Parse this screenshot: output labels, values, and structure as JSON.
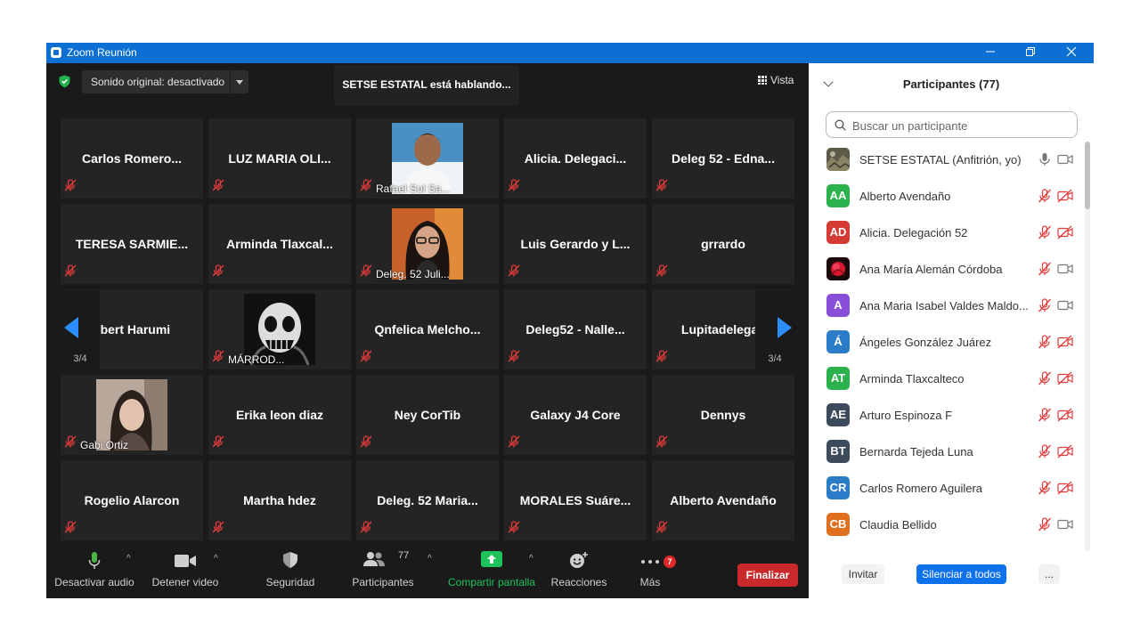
{
  "window": {
    "title": "Zoom Reunión"
  },
  "meeting": {
    "audio_setting": "Sonido original: desactivado",
    "speaking_banner": "SETSE ESTATAL está hablando...",
    "view_label": "Vista",
    "page_indicator_left": "3/4",
    "page_indicator_right": "3/4"
  },
  "tiles": [
    [
      {
        "name": "Carlos  Romero...",
        "video": false
      },
      {
        "name": "LUZ MARIA OLI...",
        "video": false
      },
      {
        "name": "Rafael Sol Sa...",
        "video": true
      },
      {
        "name": "Alicia.  Delegaci...",
        "video": false
      },
      {
        "name": "Deleg 52 - Edna...",
        "video": false
      }
    ],
    [
      {
        "name": "TERESA  SARMIE...",
        "video": false
      },
      {
        "name": "Arminda  Tlaxcal...",
        "video": false
      },
      {
        "name": "Deleg. 52 Juli...",
        "video": true
      },
      {
        "name": "Luis Gerardo y L...",
        "video": false
      },
      {
        "name": "grrardo",
        "video": false
      }
    ],
    [
      {
        "name": "Ilbert Harumi",
        "video": false
      },
      {
        "name": "MÁRROD...",
        "video": true
      },
      {
        "name": "Qnfelica  Melcho...",
        "video": false
      },
      {
        "name": "Deleg52  -  Nalle...",
        "video": false
      },
      {
        "name": "Lupitadelegac",
        "video": false
      }
    ],
    [
      {
        "name": "Gabi Ortiz",
        "video": true
      },
      {
        "name": "Erika leon diaz",
        "video": false
      },
      {
        "name": "Ney CorTib",
        "video": false
      },
      {
        "name": "Galaxy J4 Core",
        "video": false
      },
      {
        "name": "Dennys",
        "video": false
      }
    ],
    [
      {
        "name": "Rogelio Alarcon",
        "video": false
      },
      {
        "name": "Martha hdez",
        "video": false
      },
      {
        "name": "Deleg.  52  Maria...",
        "video": false
      },
      {
        "name": "MORALES  Suáre...",
        "video": false
      },
      {
        "name": "Alberto Avendaño",
        "video": false
      }
    ]
  ],
  "toolbar": {
    "mute": "Desactivar audio",
    "video": "Detener video",
    "security": "Seguridad",
    "participants": "Participantes",
    "participants_count": "77",
    "share": "Compartir pantalla",
    "reactions": "Reacciones",
    "more": "Más",
    "more_badge": "7",
    "end": "Finalizar"
  },
  "panel": {
    "title": "Participantes (77)",
    "search_placeholder": "Buscar un participante",
    "participants": [
      {
        "initials": "",
        "name": "SETSE ESTATAL (Anfitrión, yo)",
        "color": "#6b6b55",
        "photo": true,
        "mic": "on",
        "cam": "off-plain"
      },
      {
        "initials": "AA",
        "name": "Alberto Avendaño",
        "color": "#2bb24c",
        "mic": "muted",
        "cam": "muted"
      },
      {
        "initials": "AD",
        "name": "Alicia. Delegación 52",
        "color": "#d63b33",
        "mic": "muted",
        "cam": "muted"
      },
      {
        "initials": "",
        "name": "Ana María Alemán Córdoba",
        "color": "#c7142a",
        "photo": true,
        "mic": "muted",
        "cam": "off-plain"
      },
      {
        "initials": "A",
        "name": "Ana Maria Isabel Valdes Maldo...",
        "color": "#8a4fd8",
        "mic": "muted",
        "cam": "off-plain"
      },
      {
        "initials": "Á",
        "name": "Ángeles González Juárez",
        "color": "#2a7bc8",
        "mic": "muted",
        "cam": "muted"
      },
      {
        "initials": "AT",
        "name": "Arminda Tlaxcalteco",
        "color": "#2bb24c",
        "mic": "muted",
        "cam": "muted"
      },
      {
        "initials": "AE",
        "name": "Arturo Espinoza F",
        "color": "#3c4a5c",
        "mic": "muted",
        "cam": "muted"
      },
      {
        "initials": "BT",
        "name": "Bernarda Tejeda Luna",
        "color": "#3c4a5c",
        "mic": "muted",
        "cam": "muted"
      },
      {
        "initials": "CR",
        "name": "Carlos Romero Aguilera",
        "color": "#2a7bc8",
        "mic": "muted",
        "cam": "muted"
      },
      {
        "initials": "CB",
        "name": "Claudia Bellido",
        "color": "#e0701f",
        "mic": "muted",
        "cam": "off-plain"
      }
    ],
    "invite": "Invitar",
    "mute_all": "Silenciar a todos",
    "more": "..."
  },
  "colors": {
    "titlebar": "#0b6fd4",
    "end_button": "#c9292b",
    "share_green": "#1ec25b",
    "mute_all_bg": "#0e72ed"
  }
}
